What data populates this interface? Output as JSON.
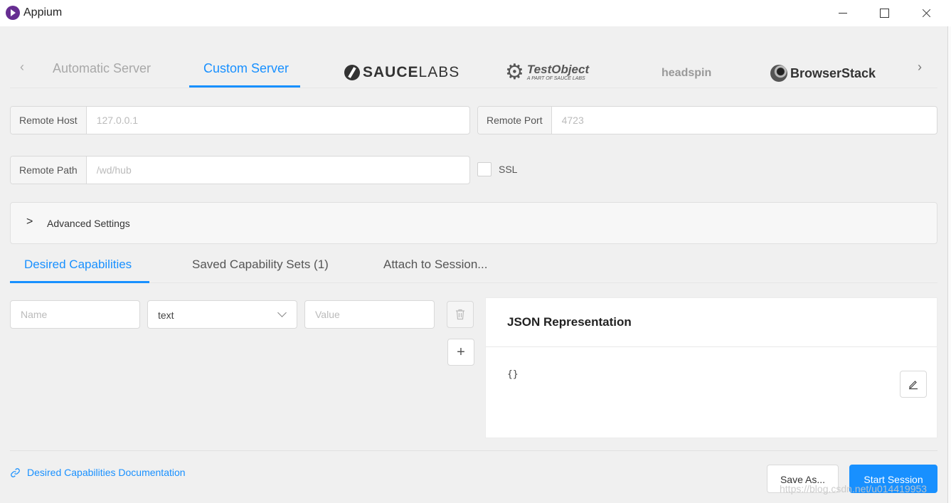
{
  "window": {
    "title": "Appium"
  },
  "server_tabs": {
    "items": [
      "Automatic Server",
      "Custom Server"
    ],
    "active": "Custom Server",
    "logos": {
      "saucelabs_bold": "SAUCE",
      "saucelabs_light": "LABS",
      "testobject_main": "TestObject",
      "testobject_sub": "A PART OF SAUCE LABS",
      "headspin": "headspin",
      "browserstack": "BrowserStack"
    }
  },
  "form": {
    "remote_host_label": "Remote Host",
    "remote_host_placeholder": "127.0.0.1",
    "remote_port_label": "Remote Port",
    "remote_port_placeholder": "4723",
    "remote_path_label": "Remote Path",
    "remote_path_placeholder": "/wd/hub",
    "ssl_label": "SSL",
    "ssl_checked": false,
    "advanced_label": "Advanced Settings"
  },
  "capability_tabs": {
    "items": [
      "Desired Capabilities",
      "Saved Capability Sets (1)",
      "Attach to Session..."
    ],
    "active": "Desired Capabilities"
  },
  "capability_row": {
    "name_placeholder": "Name",
    "type_value": "text",
    "value_placeholder": "Value"
  },
  "json_panel": {
    "title": "JSON Representation",
    "body": "{}"
  },
  "footer": {
    "doc_link": "Desired Capabilities Documentation",
    "save_as": "Save As...",
    "start_session": "Start Session"
  },
  "watermark": "https://blog.csdn.net/u014419953",
  "colors": {
    "accent": "#1890ff",
    "app_icon": "#662d91"
  }
}
